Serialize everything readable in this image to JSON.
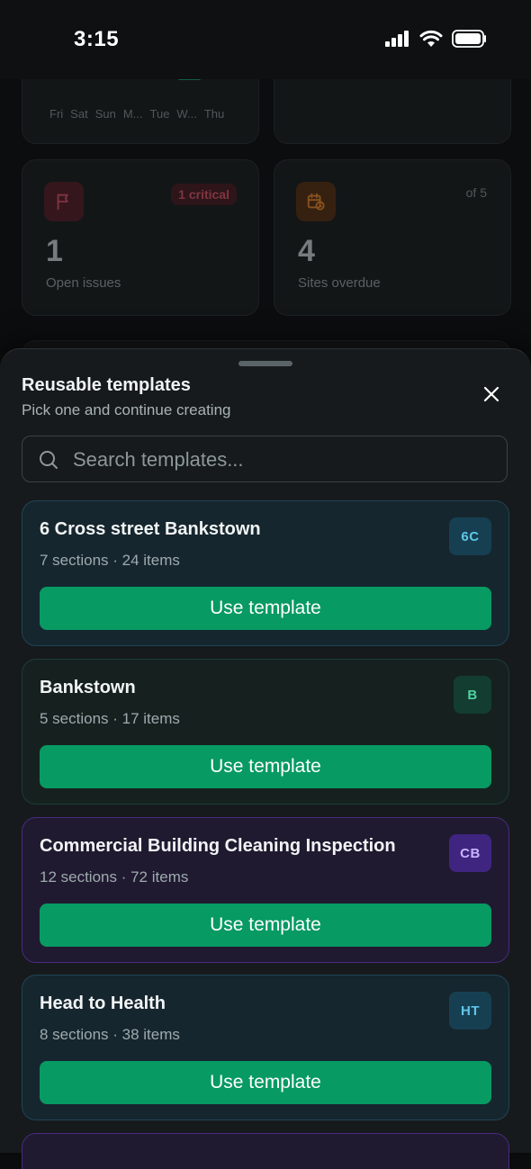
{
  "status": {
    "time": "3:15"
  },
  "dashboard": {
    "chart_days": [
      "Fri",
      "Sat",
      "Sun",
      "M...",
      "Tue",
      "W...",
      "Thu"
    ],
    "issues": {
      "value": "1",
      "label": "Open issues",
      "badge": "1 critical"
    },
    "sites": {
      "value": "4",
      "label": "Sites overdue",
      "meta": "of 5"
    }
  },
  "sheet": {
    "title": "Reusable templates",
    "subtitle": "Pick one and continue creating",
    "search_placeholder": "Search templates...",
    "templates": [
      {
        "name": "6 Cross street Bankstown",
        "meta": "7 sections · 24 items",
        "badge": "6C",
        "button": "Use template",
        "theme": "teal"
      },
      {
        "name": "Bankstown",
        "meta": "5 sections · 17 items",
        "badge": "B",
        "button": "Use template",
        "theme": "green"
      },
      {
        "name": "Commercial Building Cleaning Inspection",
        "meta": "12 sections · 72 items",
        "badge": "CB",
        "button": "Use template",
        "theme": "purple"
      },
      {
        "name": "Head to Health",
        "meta": "8 sections · 38 items",
        "badge": "HT",
        "button": "Use template",
        "theme": "teal"
      }
    ]
  },
  "colors": {
    "accent_green": "#079a63",
    "critical_red": "#e0566a",
    "overdue_orange": "#f08a2c"
  }
}
